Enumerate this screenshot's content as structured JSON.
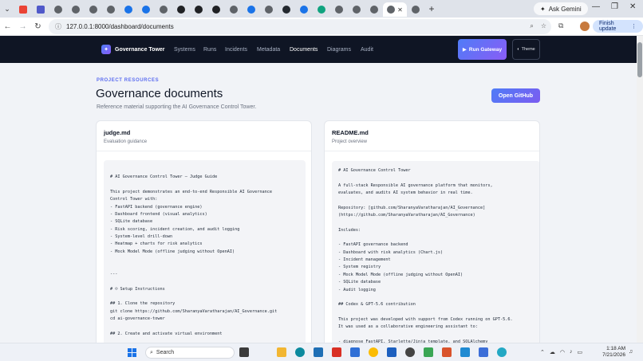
{
  "browser": {
    "ask_gemini": "Ask Gemini",
    "url": "127.0.0.1:8000/dashboard/documents",
    "finish_update": "Finish update",
    "new_tab": "+",
    "tab_close": "✕"
  },
  "app": {
    "brand": "Governance Tower",
    "nav": [
      "Systems",
      "Runs",
      "Incidents",
      "Metadata",
      "Documents",
      "Diagrams",
      "Audit"
    ],
    "active_nav": "Documents",
    "run_gateway": "Run Gateway",
    "theme": "Theme"
  },
  "page": {
    "eyebrow": "PROJECT RESOURCES",
    "title": "Governance documents",
    "subtitle": "Reference material supporting the AI Governance Control Tower.",
    "github_button": "Open GitHub"
  },
  "docs": [
    {
      "title": "judge.md",
      "subtitle": "Evaluation guidance",
      "content": "\n# AI Governance Control Tower — Judge Guide\n\nThis project demonstrates an end-to-end Responsible AI Governance\nControl Tower with:\n- FastAPI backend (governance engine)\n- Dashboard frontend (visual analytics)\n- SQLite database\n- Risk scoring, incident creation, and audit logging\n- System-level drill-down\n- Heatmap + charts for risk analytics\n- Mock Model Mode (offline judging without OpenAI)\n\n\n---\n\n# ☺ Setup Instructions\n\n## 1. Clone the repository\ngit clone https://github.com/SharanyaVaratharajan/AI_Governance.git\ncd ai-governance-tower\n\n## 2. Create and activate virtual environment"
    },
    {
      "title": "README.md",
      "subtitle": "Project overview",
      "content": "# AI Governance Control Tower\n\nA full-stack Responsible AI governance platform that monitors,\nevaluates, and audits AI system behavior in real time.\n\nRepository: [github.com/SharanyaVaratharajan/AI_Governance]\n(https://github.com/SharanyaVaratharajan/AI_Governance)\n\nIncludes:\n\n- FastAPI governance backend\n- Dashboard with risk analytics (Chart.js)\n- Incident management\n- System registry\n- Mock Model Mode (offline judging without OpenAI)\n- SQLite database\n- Audit logging\n\n## Codex & GPT-5.6 contribution\n\nThis project was developed with support from Codex running on GPT-5.6.\nIt was used as a collaborative engineering assistant to:\n\n- diagnose FastAPI, Starlette/Jinja template, and SQLAlchemy"
    }
  ],
  "taskbar": {
    "search": "Search",
    "time": "1:18 AM",
    "date": "7/21/2026"
  }
}
